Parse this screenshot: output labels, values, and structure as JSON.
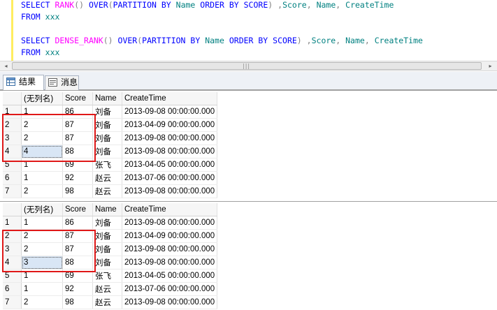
{
  "editor": {
    "q1_line1": {
      "select": "SELECT",
      "func": "RANK",
      "parens": "()",
      "over": "OVER",
      "open": "(",
      "partition": "PARTITION BY",
      "name": "Name",
      "order": "ORDER BY",
      "score": "SCORE",
      "close": ")",
      "comma1": ",",
      "col1": "Score",
      "comma2": ",",
      "col2": "Name",
      "comma3": ",",
      "col3": "CreateTime"
    },
    "q1_line2": {
      "from": "FROM",
      "table": "xxx"
    },
    "q2_line1": {
      "select": "SELECT",
      "func": "DENSE_RANK",
      "parens": "()",
      "over": "OVER",
      "open": "(",
      "partition": "PARTITION BY",
      "name": "Name",
      "order": "ORDER BY",
      "score": "SCORE",
      "close": ")",
      "comma1": ",",
      "col1": "Score",
      "comma2": ",",
      "col2": "Name",
      "comma3": ",",
      "col3": "CreateTime"
    },
    "q2_line2": {
      "from": "FROM",
      "table": "xxx"
    }
  },
  "scrollbar": {
    "left_arrow": "◂",
    "right_arrow": "▸",
    "grip": "|||"
  },
  "tabs": {
    "results": "结果",
    "messages": "消息"
  },
  "grid1": {
    "headers": [
      "",
      "(无列名)",
      "Score",
      "Name",
      "CreateTime"
    ],
    "rows": [
      [
        "1",
        "1",
        "86",
        "刘备",
        "2013-09-08 00:00:00.000"
      ],
      [
        "2",
        "2",
        "87",
        "刘备",
        "2013-04-09 00:00:00.000"
      ],
      [
        "3",
        "2",
        "87",
        "刘备",
        "2013-09-08 00:00:00.000"
      ],
      [
        "4",
        "4",
        "88",
        "刘备",
        "2013-09-08 00:00:00.000"
      ],
      [
        "5",
        "1",
        "69",
        "张飞",
        "2013-04-05 00:00:00.000"
      ],
      [
        "6",
        "1",
        "92",
        "赵云",
        "2013-07-06 00:00:00.000"
      ],
      [
        "7",
        "2",
        "98",
        "赵云",
        "2013-09-08 00:00:00.000"
      ]
    ]
  },
  "grid2": {
    "headers": [
      "",
      "(无列名)",
      "Score",
      "Name",
      "CreateTime"
    ],
    "rows": [
      [
        "1",
        "1",
        "86",
        "刘备",
        "2013-09-08 00:00:00.000"
      ],
      [
        "2",
        "2",
        "87",
        "刘备",
        "2013-04-09 00:00:00.000"
      ],
      [
        "3",
        "2",
        "87",
        "刘备",
        "2013-09-08 00:00:00.000"
      ],
      [
        "4",
        "3",
        "88",
        "刘备",
        "2013-09-08 00:00:00.000"
      ],
      [
        "5",
        "1",
        "69",
        "张飞",
        "2013-04-05 00:00:00.000"
      ],
      [
        "6",
        "1",
        "92",
        "赵云",
        "2013-07-06 00:00:00.000"
      ],
      [
        "7",
        "2",
        "98",
        "赵云",
        "2013-09-08 00:00:00.000"
      ]
    ]
  },
  "colors": {
    "highlight_box": "#e01818",
    "selected_cell": "#d9e6f5",
    "keyword": "#0000ff",
    "function": "#ff00ff",
    "identifier": "#008080",
    "operator": "#808080"
  }
}
